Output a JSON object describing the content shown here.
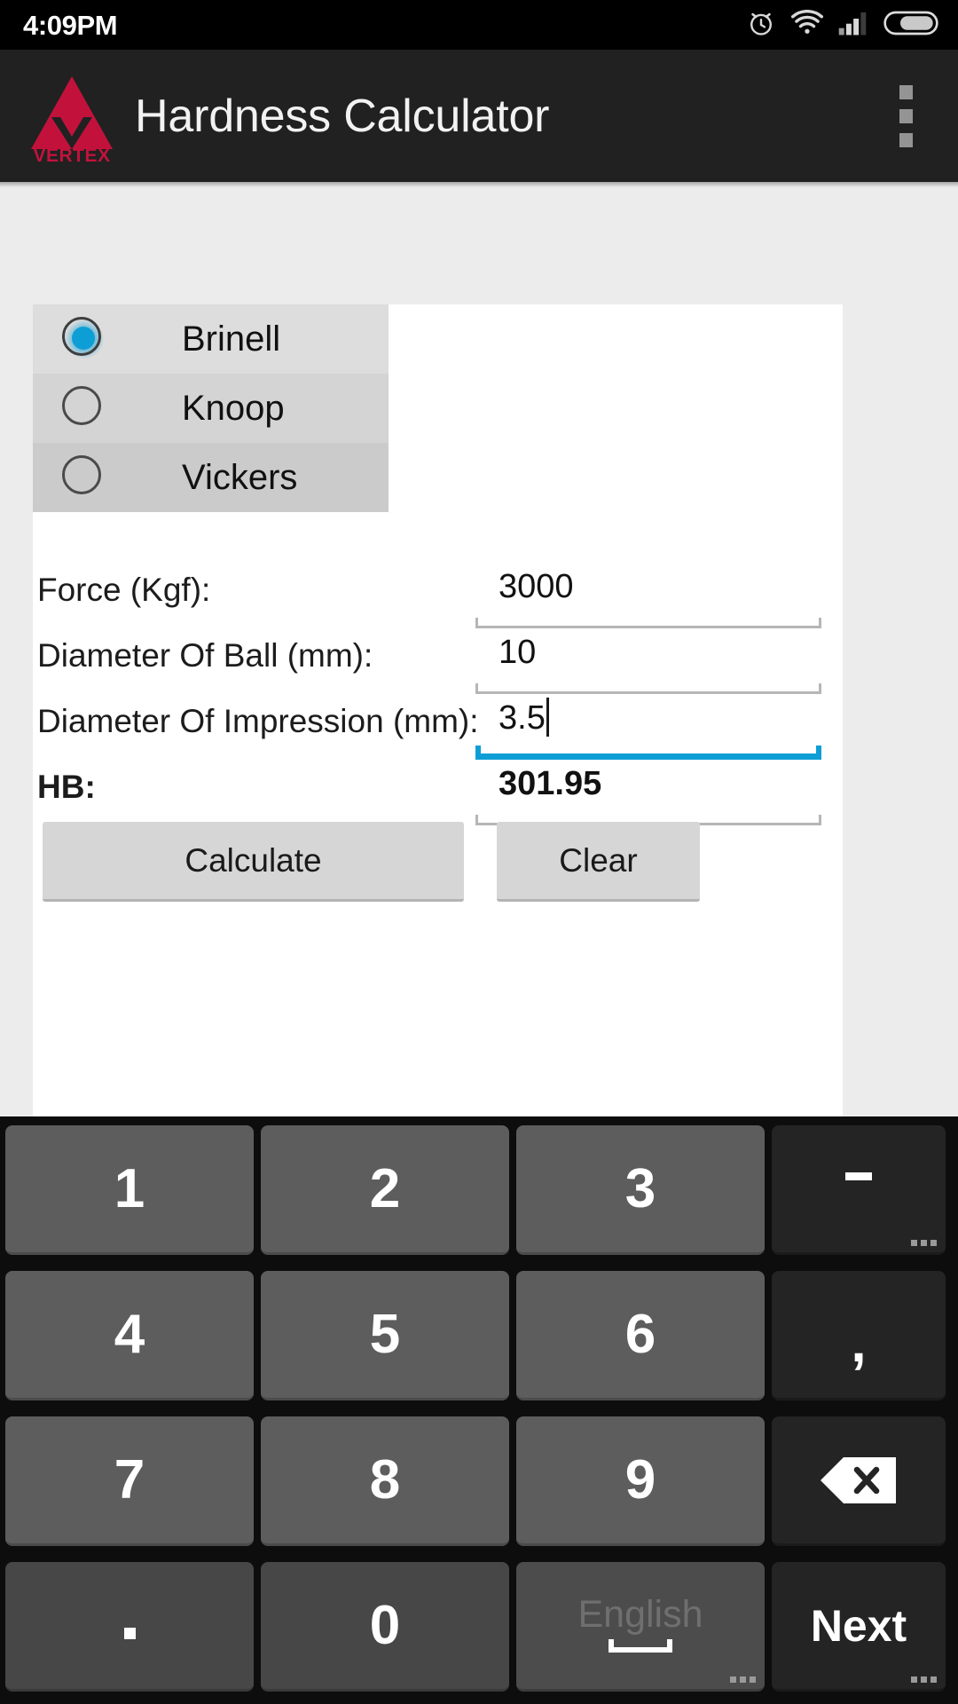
{
  "status_bar": {
    "time": "4:09PM",
    "icons": [
      "alarm-icon",
      "wifi-icon",
      "signal-icon",
      "battery-icon"
    ],
    "signal_bars_filled": 3,
    "signal_bars_total": 4,
    "battery_percent": 72,
    "background": "#000000"
  },
  "app_bar": {
    "title": "Hardness Calculator",
    "logo_text": "VERTEX",
    "logo_color": "#c2123c",
    "background": "#212121",
    "overflow_icon": "overflow-menu-icon"
  },
  "hardness_methods": {
    "selected": "Brinell",
    "options": [
      {
        "label": "Brinell",
        "checked": true
      },
      {
        "label": "Knoop",
        "checked": false
      },
      {
        "label": "Vickers",
        "checked": false
      }
    ],
    "accent_color": "#0e9ed6"
  },
  "form": {
    "fields": [
      {
        "label": "Force (Kgf):",
        "value": "3000",
        "focused": false,
        "bold": false
      },
      {
        "label": "Diameter Of Ball (mm):",
        "value": "10",
        "focused": false,
        "bold": false
      },
      {
        "label": "Diameter Of Impression (mm):",
        "value": "3.5",
        "focused": true,
        "bold": false
      },
      {
        "label": "HB:",
        "value": "301.95",
        "focused": false,
        "bold": true
      }
    ]
  },
  "buttons": {
    "calculate": "Calculate",
    "clear": "Clear"
  },
  "keyboard": {
    "rows": [
      [
        {
          "label": "1",
          "type": "num"
        },
        {
          "label": "2",
          "type": "num"
        },
        {
          "label": "3",
          "type": "num"
        },
        {
          "label": "-",
          "type": "fn",
          "glyph": "dash-glyph",
          "more": true
        }
      ],
      [
        {
          "label": "4",
          "type": "num"
        },
        {
          "label": "5",
          "type": "num"
        },
        {
          "label": "6",
          "type": "num"
        },
        {
          "label": ",",
          "type": "fn",
          "glyph": "comma-glyph",
          "more": false
        }
      ],
      [
        {
          "label": "7",
          "type": "num"
        },
        {
          "label": "8",
          "type": "num"
        },
        {
          "label": "9",
          "type": "num"
        },
        {
          "label": "",
          "type": "fn",
          "glyph": "backspace-icon",
          "more": false
        }
      ],
      [
        {
          "label": ".",
          "type": "num-dim",
          "glyph": "period-glyph"
        },
        {
          "label": "0",
          "type": "num-dim"
        },
        {
          "label": "English",
          "type": "space",
          "glyph": "spacebar-glyph",
          "more": true
        },
        {
          "label": "Next",
          "type": "fn",
          "more": true
        }
      ]
    ],
    "background": "#0d0d0d"
  }
}
